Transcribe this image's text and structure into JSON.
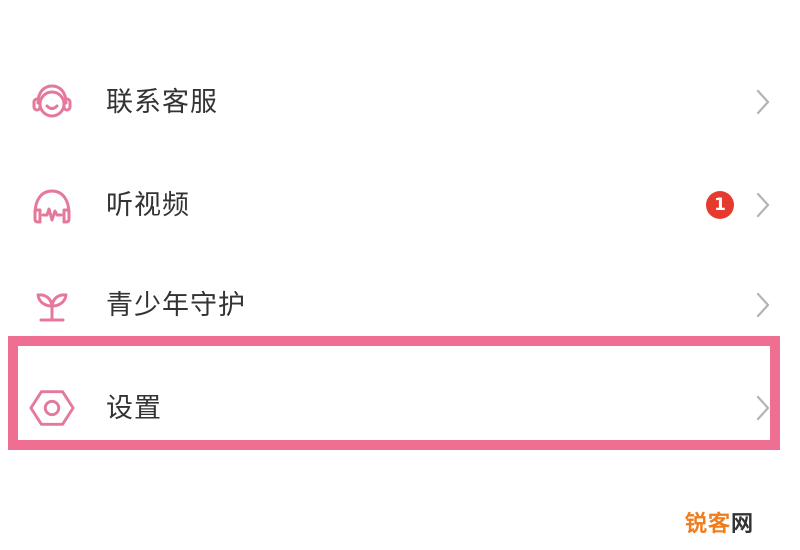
{
  "colors": {
    "icon": "#e5799b",
    "label": "#333333",
    "chevron": "#b3b3b3",
    "badge": "#e63a2e",
    "highlight": "#ee6f92",
    "watermark_orange": "#f07c1a"
  },
  "menu": {
    "items": [
      {
        "label": "联系客服",
        "icon": "customer-service-icon"
      },
      {
        "label": "听视频",
        "icon": "headphones-icon",
        "badge": "1"
      },
      {
        "label": "青少年守护",
        "icon": "sprout-icon"
      },
      {
        "label": "设置",
        "icon": "settings-hex-icon",
        "highlighted": true
      }
    ]
  },
  "watermark": {
    "part1": "锐",
    "part2": "客",
    "part3": "网"
  }
}
